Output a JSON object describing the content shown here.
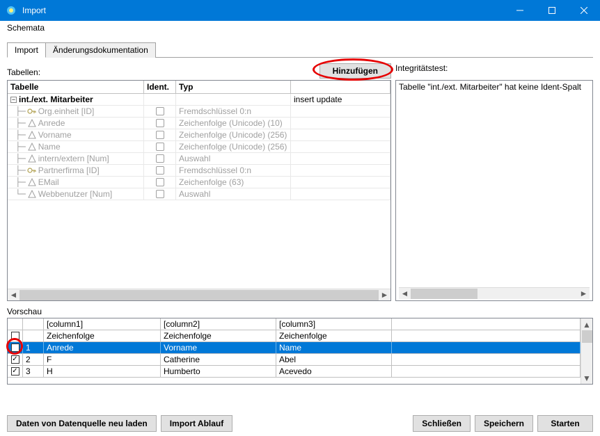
{
  "window": {
    "title": "Import"
  },
  "menu": {
    "schemata": "Schemata"
  },
  "tabs": {
    "import": "Import",
    "aenderung": "Änderungsdokumentation"
  },
  "sections": {
    "tabellen": "Tabellen:",
    "integ": "Integritätstest:",
    "vorschau": "Vorschau"
  },
  "buttons": {
    "hinzufuegen": "Hinzufügen",
    "daten_neu": "Daten von Datenquelle neu laden",
    "import_ablauf": "Import Ablauf",
    "schliessen": "Schließen",
    "speichern": "Speichern",
    "starten": "Starten"
  },
  "grid_headers": {
    "tabelle": "Tabelle",
    "ident": "Ident.",
    "typ": "Typ",
    "extra": ""
  },
  "tree": {
    "root": "int./ext. Mitarbeiter",
    "root_extra": "insert update",
    "items": [
      {
        "label": "Org.einheit [ID]",
        "icon": "key",
        "typ": "Fremdschlüssel 0:n"
      },
      {
        "label": "Anrede",
        "icon": "col",
        "typ": "Zeichenfolge (Unicode) (10)"
      },
      {
        "label": "Vorname",
        "icon": "col",
        "typ": "Zeichenfolge (Unicode) (256)"
      },
      {
        "label": "Name",
        "icon": "col",
        "typ": "Zeichenfolge (Unicode) (256)"
      },
      {
        "label": "intern/extern [Num]",
        "icon": "col",
        "typ": "Auswahl"
      },
      {
        "label": "Partnerfirma [ID]",
        "icon": "key",
        "typ": "Fremdschlüssel 0:n"
      },
      {
        "label": "EMail",
        "icon": "col",
        "typ": "Zeichenfolge (63)"
      },
      {
        "label": "Webbenutzer [Num]",
        "icon": "col",
        "typ": "Auswahl"
      }
    ]
  },
  "integ_text": "Tabelle \"int./ext. Mitarbeiter\" hat keine Ident-Spalt",
  "preview": {
    "headers": {
      "c1": "[column1]",
      "c2": "[column2]",
      "c3": "[column3]"
    },
    "rows": [
      {
        "n": "",
        "chk": false,
        "c1": "Zeichenfolge",
        "c2": "Zeichenfolge",
        "c3": "Zeichenfolge",
        "sel": false
      },
      {
        "n": "1",
        "chk": false,
        "c1": "Anrede",
        "c2": "Vorname",
        "c3": "Name",
        "sel": true
      },
      {
        "n": "2",
        "chk": true,
        "c1": "F",
        "c2": "Catherine",
        "c3": "Abel",
        "sel": false
      },
      {
        "n": "3",
        "chk": true,
        "c1": "H",
        "c2": "Humberto",
        "c3": "Acevedo",
        "sel": false
      }
    ]
  }
}
